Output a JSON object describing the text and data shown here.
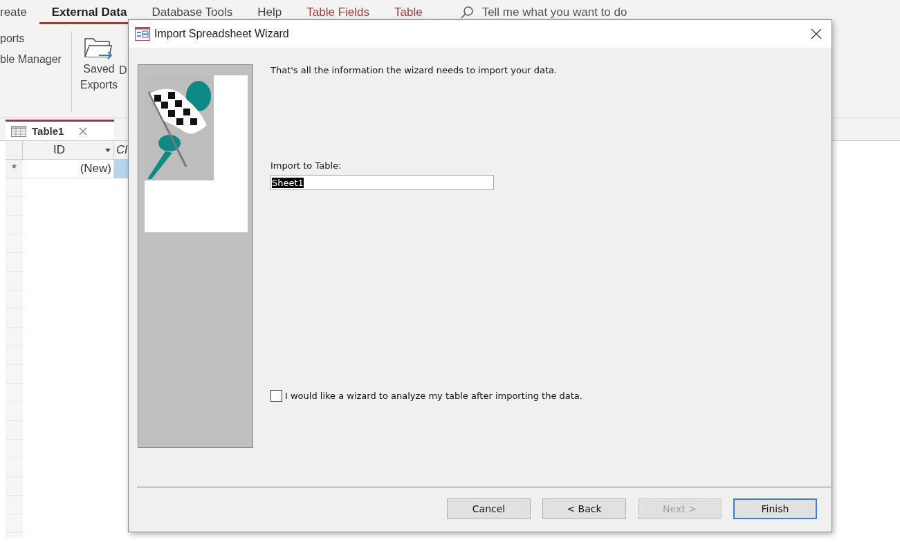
{
  "ribbon": {
    "tabs": [
      {
        "label": "reate",
        "selected": false,
        "kind": "normal"
      },
      {
        "label": "External Data",
        "selected": true,
        "kind": "normal"
      },
      {
        "label": "Database Tools",
        "selected": false,
        "kind": "normal"
      },
      {
        "label": "Help",
        "selected": false,
        "kind": "normal"
      },
      {
        "label": "Table Fields",
        "selected": false,
        "kind": "contextual"
      },
      {
        "label": "Table",
        "selected": false,
        "kind": "contextual"
      }
    ],
    "search": {
      "placeholder": "Tell me what you want to do"
    },
    "commands": [
      "ports",
      "ble Manager"
    ],
    "saved_exports": "Saved Exports",
    "cut_command": "D"
  },
  "document_tab": {
    "label": "Table1"
  },
  "datasheet": {
    "columns": [
      "ID",
      "Cl"
    ],
    "new_row": {
      "selector": "*",
      "id": "(New)"
    }
  },
  "dialog": {
    "title": "Import Spreadsheet Wizard",
    "message": "That's all the information the wizard needs to import your data.",
    "table_label": "Import to Table:",
    "table_name": "Sheet1",
    "analyze": {
      "label": "I would like a wizard to analyze my table after importing the data.",
      "checked": false
    },
    "buttons": [
      {
        "label": "Cancel",
        "disabled": false,
        "default": false
      },
      {
        "label": "< Back",
        "disabled": false,
        "default": false
      },
      {
        "label": "Next >",
        "disabled": true,
        "default": false
      },
      {
        "label": "Finish",
        "disabled": false,
        "default": true
      }
    ]
  }
}
